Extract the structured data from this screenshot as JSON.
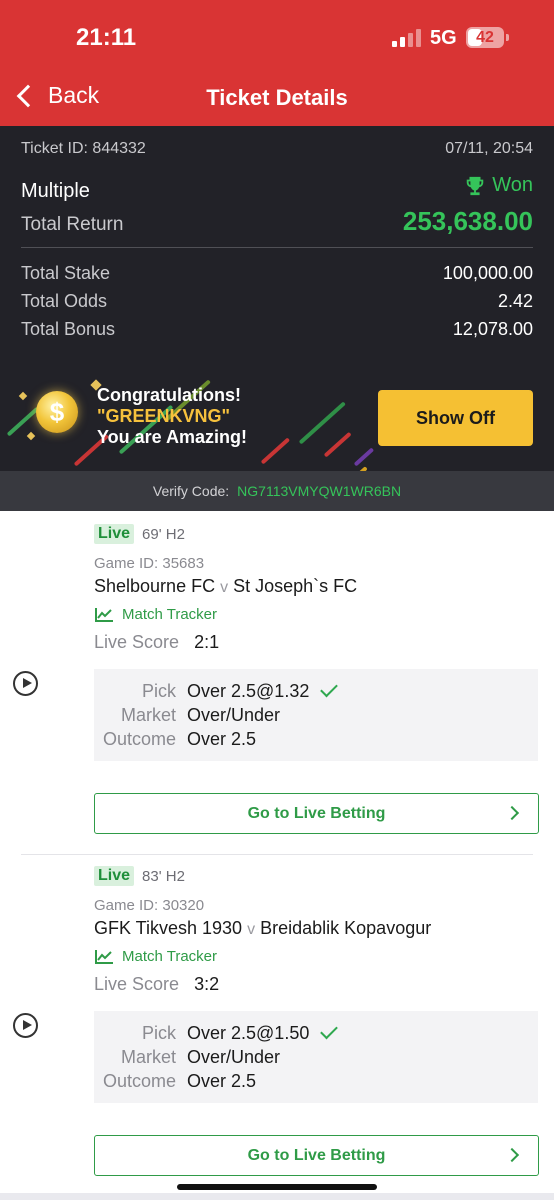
{
  "status": {
    "time": "21:11",
    "network": "5G",
    "battery": "42",
    "battery_level": 0.42
  },
  "nav": {
    "back_label": "Back",
    "title": "Ticket Details"
  },
  "ticket": {
    "id_text": "Ticket ID: 844332",
    "datetime": "07/11, 20:54",
    "type": "Multiple",
    "status": "Won",
    "return_label": "Total Return",
    "return_value": "253,638.00",
    "stake_label": "Total Stake",
    "stake_value": "100,000.00",
    "odds_label": "Total Odds",
    "odds_value": "2.42",
    "bonus_label": "Total Bonus",
    "bonus_value": "12,078.00"
  },
  "promo": {
    "coin_symbol": "$",
    "line1": "Congratulations!",
    "line2": "\"GREENKVNG\"",
    "line3": "You are Amazing!",
    "button": "Show Off"
  },
  "verify": {
    "label": "Verify Code:",
    "code": "NG7113VMYQW1WR6BN"
  },
  "bets": [
    {
      "live": "Live",
      "time": "69' H2",
      "game_id": "Game ID: 35683",
      "home": "Shelbourne FC",
      "vs": "v",
      "away": "St Joseph`s FC",
      "tracker": "Match Tracker",
      "score_label": "Live Score",
      "score": "2:1",
      "pick_label": "Pick",
      "pick": "Over 2.5@1.32",
      "market_label": "Market",
      "market": "Over/Under",
      "outcome_label": "Outcome",
      "outcome": "Over 2.5",
      "button": "Go to Live Betting"
    },
    {
      "live": "Live",
      "time": "83' H2",
      "game_id": "Game ID: 30320",
      "home": "GFK Tikvesh 1930",
      "vs": "v",
      "away": "Breidablik Kopavogur",
      "tracker": "Match Tracker",
      "score_label": "Live Score",
      "score": "3:2",
      "pick_label": "Pick",
      "pick": "Over 2.5@1.50",
      "market_label": "Market",
      "market": "Over/Under",
      "outcome_label": "Outcome",
      "outcome": "Over 2.5",
      "button": "Go to Live Betting"
    }
  ],
  "colors": {
    "brand_red": "#d93434",
    "win_green": "#35c45a",
    "accent_yellow": "#f5c033",
    "dark_bg": "#222228"
  }
}
